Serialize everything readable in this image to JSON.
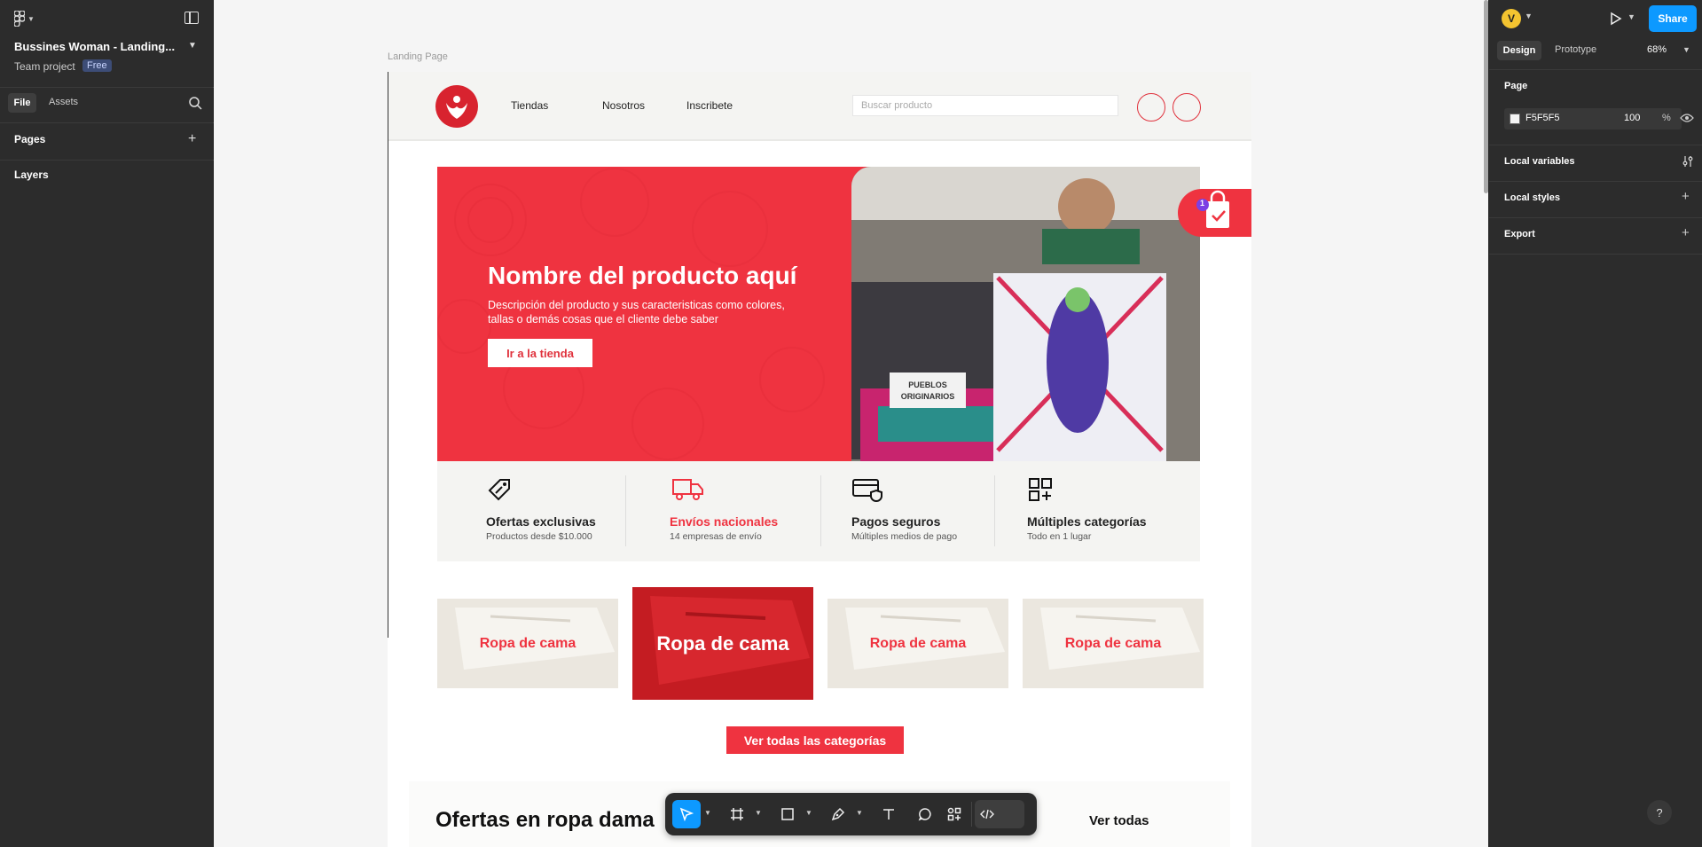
{
  "left_panel": {
    "file_name": "Bussines Woman - Landing...",
    "team": "Team project",
    "plan_badge": "Free",
    "tabs": [
      "File",
      "Assets"
    ],
    "pages_heading": "Pages",
    "layers_heading": "Layers"
  },
  "right_panel": {
    "avatar_initial": "V",
    "share_label": "Share",
    "tabs": [
      "Design",
      "Prototype"
    ],
    "zoom": "68%",
    "page_heading": "Page",
    "page_color_hex": "F5F5F5",
    "page_opacity": "100",
    "opacity_unit": "%",
    "sections": [
      "Local variables",
      "Local styles",
      "Export"
    ],
    "help": "?"
  },
  "canvas": {
    "frame_label": "Landing Page",
    "nav": {
      "links": [
        "Tiendas",
        "Nosotros",
        "Inscribete"
      ],
      "search_placeholder": "Buscar producto"
    },
    "hero": {
      "title": "Nombre del producto aquí",
      "description": "Descripción del producto y sus caracteristicas como colores, tallas o demás cosas que el cliente debe saber",
      "button": "Ir a la tienda",
      "photo_sign": "PUEBLOS ORIGINARIOS",
      "cart_count": "1"
    },
    "features": [
      {
        "title": "Ofertas exclusivas",
        "subtitle": "Productos desde $10.000"
      },
      {
        "title": "Envíos nacionales",
        "subtitle": "14 empresas de envío"
      },
      {
        "title": "Pagos seguros",
        "subtitle": "Múltiples medios de pago"
      },
      {
        "title": "Múltiples categorías",
        "subtitle": "Todo en 1 lugar"
      }
    ],
    "categories": [
      "Ropa de cama",
      "Ropa de cama",
      "Ropa de cama",
      "Ropa de cama"
    ],
    "all_categories_button": "Ver todas las categorías",
    "offers_title": "Ofertas en ropa dama",
    "offers_link": "Ver todas"
  },
  "colors": {
    "accent": "#ef3340",
    "figma_blue": "#0d99ff",
    "panel": "#2c2c2c",
    "canvas_bg": "#f5f5f5"
  },
  "toolbar_icons": [
    "move-icon",
    "frame-icon",
    "rectangle-icon",
    "pen-icon",
    "text-icon",
    "comment-icon",
    "actions-icon",
    "dev-mode-icon"
  ]
}
